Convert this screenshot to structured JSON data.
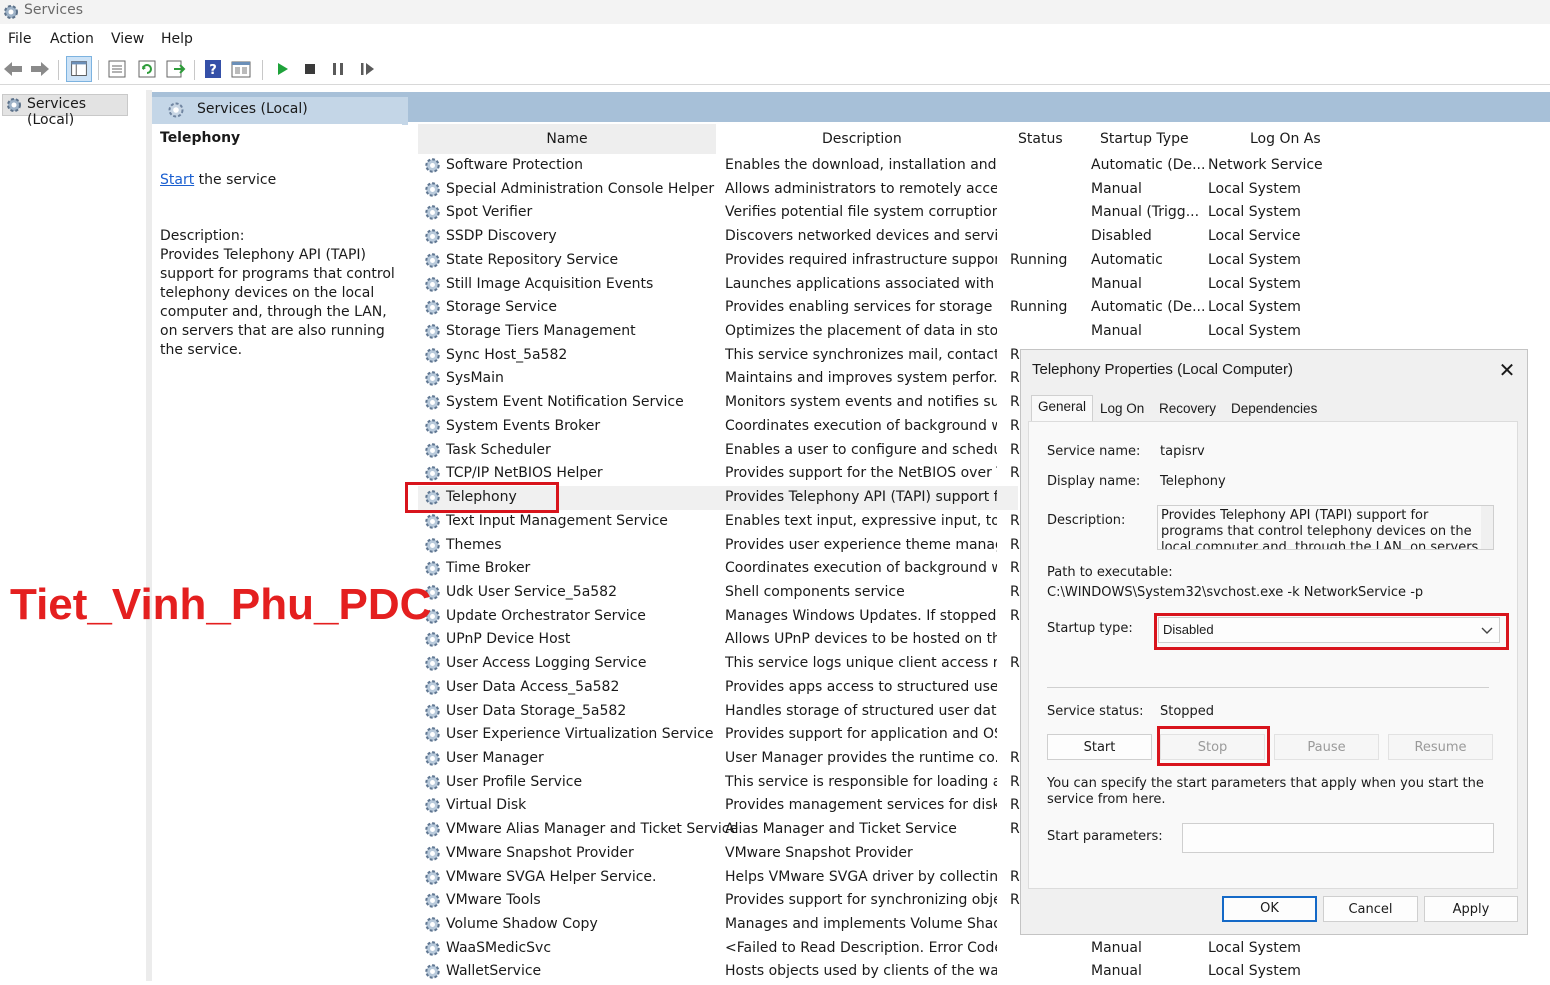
{
  "window": {
    "title": "Services"
  },
  "menu": [
    "File",
    "Action",
    "View",
    "Help"
  ],
  "toolbar_icons": [
    "back-icon",
    "forward-icon",
    "show-hide-tree-icon",
    "properties-icon",
    "refresh-icon",
    "export-list-icon",
    "help-icon",
    "console-icon",
    "start-service-icon",
    "stop-service-icon",
    "pause-service-icon",
    "resume-service-icon"
  ],
  "tree": {
    "item": "Services (Local)"
  },
  "header": {
    "title": "Services (Local)"
  },
  "detail": {
    "name": "Telephony",
    "start_link": "Start",
    "start_suffix": " the service",
    "description_label": "Description:",
    "description": "Provides Telephony API (TAPI) support for programs that control telephony devices on the local computer and, through the LAN, on servers that are also running the service."
  },
  "columns": {
    "name": "Name",
    "description": "Description",
    "status": "Status",
    "startup": "Startup Type",
    "logon": "Log On As"
  },
  "services": [
    {
      "name": "Software Protection",
      "desc": "Enables the download, installation and ...",
      "status": "",
      "startup": "Automatic (De...",
      "logon": "Network Service"
    },
    {
      "name": "Special Administration Console Helper",
      "desc": "Allows administrators to remotely acces...",
      "status": "",
      "startup": "Manual",
      "logon": "Local System"
    },
    {
      "name": "Spot Verifier",
      "desc": "Verifies potential file system corruptions.",
      "status": "",
      "startup": "Manual (Trigg...",
      "logon": "Local System"
    },
    {
      "name": "SSDP Discovery",
      "desc": "Discovers networked devices and servic...",
      "status": "",
      "startup": "Disabled",
      "logon": "Local Service"
    },
    {
      "name": "State Repository Service",
      "desc": "Provides required infrastructure support...",
      "status": "Running",
      "startup": "Automatic",
      "logon": "Local System"
    },
    {
      "name": "Still Image Acquisition Events",
      "desc": "Launches applications associated with st...",
      "status": "",
      "startup": "Manual",
      "logon": "Local System"
    },
    {
      "name": "Storage Service",
      "desc": "Provides enabling services for storage s...",
      "status": "Running",
      "startup": "Automatic (De...",
      "logon": "Local System"
    },
    {
      "name": "Storage Tiers Management",
      "desc": "Optimizes the placement of data in stor...",
      "status": "",
      "startup": "Manual",
      "logon": "Local System"
    },
    {
      "name": "Sync Host_5a582",
      "desc": "This service synchronizes mail, contacts, ...",
      "status": "R",
      "startup": "",
      "logon": ""
    },
    {
      "name": "SysMain",
      "desc": "Maintains and improves system perfor...",
      "status": "R",
      "startup": "",
      "logon": ""
    },
    {
      "name": "System Event Notification Service",
      "desc": "Monitors system events and notifies su...",
      "status": "R",
      "startup": "",
      "logon": ""
    },
    {
      "name": "System Events Broker",
      "desc": "Coordinates execution of background w...",
      "status": "R",
      "startup": "",
      "logon": ""
    },
    {
      "name": "Task Scheduler",
      "desc": "Enables a user to configure and schedul...",
      "status": "R",
      "startup": "",
      "logon": ""
    },
    {
      "name": "TCP/IP NetBIOS Helper",
      "desc": "Provides support for the NetBIOS over T...",
      "status": "R",
      "startup": "",
      "logon": ""
    },
    {
      "name": "Telephony",
      "desc": "Provides Telephony API (TAPI) support fo...",
      "status": "",
      "startup": "",
      "logon": "",
      "selected": true
    },
    {
      "name": "Text Input Management Service",
      "desc": "Enables text input, expressive input, tou...",
      "status": "R",
      "startup": "",
      "logon": ""
    },
    {
      "name": "Themes",
      "desc": "Provides user experience theme manage...",
      "status": "R",
      "startup": "",
      "logon": ""
    },
    {
      "name": "Time Broker",
      "desc": "Coordinates execution of background w...",
      "status": "R",
      "startup": "",
      "logon": ""
    },
    {
      "name": "Udk User Service_5a582",
      "desc": "Shell components service",
      "status": "R",
      "startup": "",
      "logon": ""
    },
    {
      "name": "Update Orchestrator Service",
      "desc": "Manages Windows Updates. If stopped, ...",
      "status": "R",
      "startup": "",
      "logon": ""
    },
    {
      "name": "UPnP Device Host",
      "desc": "Allows UPnP devices to be hosted on thi...",
      "status": "",
      "startup": "",
      "logon": ""
    },
    {
      "name": "User Access Logging Service",
      "desc": "This service logs unique client access re...",
      "status": "R",
      "startup": "",
      "logon": ""
    },
    {
      "name": "User Data Access_5a582",
      "desc": "Provides apps access to structured user ...",
      "status": "",
      "startup": "",
      "logon": ""
    },
    {
      "name": "User Data Storage_5a582",
      "desc": "Handles storage of structured user data,...",
      "status": "",
      "startup": "",
      "logon": ""
    },
    {
      "name": "User Experience Virtualization Service",
      "desc": "Provides support for application and OS...",
      "status": "",
      "startup": "",
      "logon": ""
    },
    {
      "name": "User Manager",
      "desc": "User Manager provides the runtime co...",
      "status": "R",
      "startup": "",
      "logon": ""
    },
    {
      "name": "User Profile Service",
      "desc": "This service is responsible for loading a...",
      "status": "R",
      "startup": "",
      "logon": ""
    },
    {
      "name": "Virtual Disk",
      "desc": "Provides management services for disks,...",
      "status": "R",
      "startup": "",
      "logon": ""
    },
    {
      "name": "VMware Alias Manager and Ticket Service",
      "desc": "Alias Manager and Ticket Service",
      "status": "R",
      "startup": "",
      "logon": ""
    },
    {
      "name": "VMware Snapshot Provider",
      "desc": "VMware Snapshot Provider",
      "status": "",
      "startup": "",
      "logon": ""
    },
    {
      "name": "VMware SVGA Helper Service.",
      "desc": "Helps VMware SVGA driver by collecting...",
      "status": "R",
      "startup": "",
      "logon": ""
    },
    {
      "name": "VMware Tools",
      "desc": "Provides support for synchronizing obje...",
      "status": "R",
      "startup": "",
      "logon": ""
    },
    {
      "name": "Volume Shadow Copy",
      "desc": "Manages and implements Volume Shad...",
      "status": "",
      "startup": "",
      "logon": ""
    },
    {
      "name": "WaaSMedicSvc",
      "desc": "<Failed to Read Description. Error Code:...",
      "status": "",
      "startup": "Manual",
      "logon": "Local System"
    },
    {
      "name": "WalletService",
      "desc": "Hosts objects used by clients of the wallet",
      "status": "",
      "startup": "Manual",
      "logon": "Local System"
    }
  ],
  "watermark": "Tiet_Vinh_Phu_PDC",
  "dialog": {
    "title": "Telephony Properties (Local Computer)",
    "tabs": [
      "General",
      "Log On",
      "Recovery",
      "Dependencies"
    ],
    "service_name_label": "Service name:",
    "service_name": "tapisrv",
    "display_name_label": "Display name:",
    "display_name": "Telephony",
    "description_label": "Description:",
    "description": "Provides Telephony API (TAPI) support for programs that control telephony devices on the local computer and, through the LAN, on servers that are also",
    "path_label": "Path to executable:",
    "path": "C:\\WINDOWS\\System32\\svchost.exe -k NetworkService -p",
    "startup_label": "Startup type:",
    "startup_value": "Disabled",
    "status_label": "Service status:",
    "status_value": "Stopped",
    "btn_start": "Start",
    "btn_stop": "Stop",
    "btn_pause": "Pause",
    "btn_resume": "Resume",
    "hint": "You can specify the start parameters that apply when you start the service from here.",
    "params_label": "Start parameters:",
    "params_value": "",
    "ok": "OK",
    "cancel": "Cancel",
    "apply": "Apply"
  }
}
